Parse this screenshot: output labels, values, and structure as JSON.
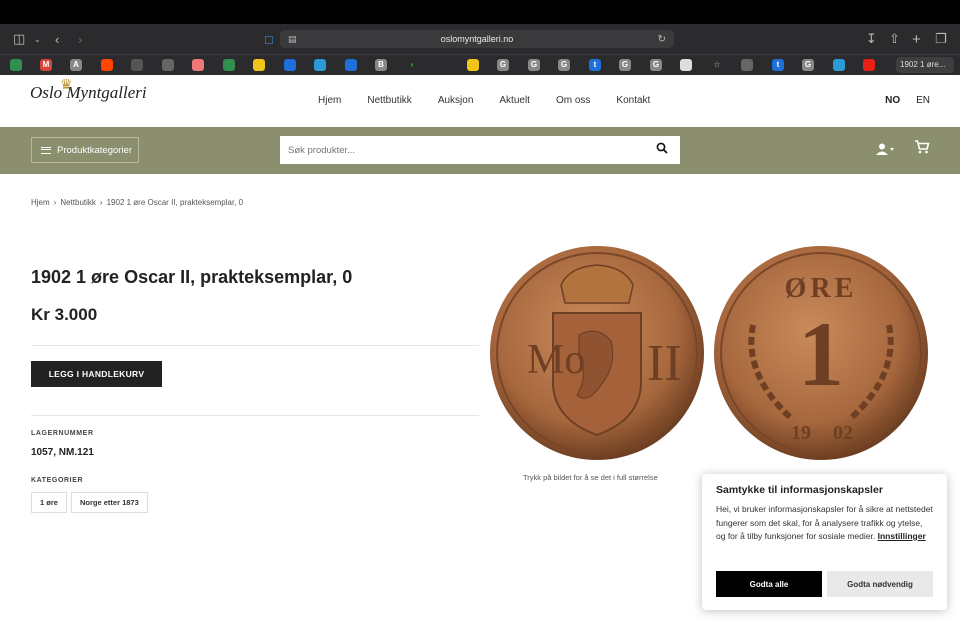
{
  "browser": {
    "url": "oslomyntgalleri.no",
    "tab_label": "1902 1 øre..."
  },
  "site": {
    "logo_text": "Oslo Myntgalleri",
    "nav": [
      "Hjem",
      "Nettbutikk",
      "Auksjon",
      "Aktuelt",
      "Om oss",
      "Kontakt"
    ],
    "lang": [
      "NO",
      "EN"
    ],
    "category_button": "Produktkategorier",
    "search_placeholder": "Søk produkter..."
  },
  "breadcrumb": [
    "Hjem",
    "Nettbutikk",
    "1902 1 øre Oscar II, prakteksemplar, 0"
  ],
  "product": {
    "title": "1902 1 øre Oscar II, prakteksemplar, 0",
    "price": "Kr  3.000",
    "add_to_cart": "LEGG I HANDLEKURV",
    "sku_label": "LAGERNUMMER",
    "sku": "1057, NM.121",
    "category_label": "KATEGORIER",
    "categories": [
      "1 øre",
      "Norge etter 1873"
    ],
    "image_caption": "Trykk på bildet for å se det i full størrelse",
    "coin_obverse": [
      "Mo",
      "II"
    ],
    "coin_reverse": [
      "ØRE",
      "1",
      "19",
      "02"
    ]
  },
  "cookie": {
    "title": "Samtykke til informasjonskapsler",
    "text": "Hei, vi bruker informasjonskapsler for å sikre at nettstedet fungerer som det skal, for å analysere trafikk og ytelse, og for å tilby funksjoner for sosiale medier.",
    "settings_link": "Innstillinger",
    "accept_all": "Godta alle",
    "accept_necessary": "Godta nødvendig"
  },
  "colors": {
    "band": "#8b8f6e",
    "coin": "#a8683e"
  }
}
